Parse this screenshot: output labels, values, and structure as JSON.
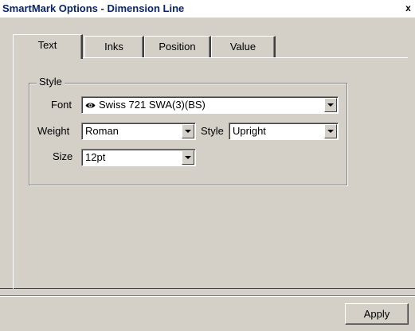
{
  "window": {
    "title": "SmartMark Options - Dimension Line",
    "close_label": "x"
  },
  "tabs": [
    {
      "label": "Text",
      "active": true
    },
    {
      "label": "Inks",
      "active": false
    },
    {
      "label": "Position",
      "active": false
    },
    {
      "label": "Value",
      "active": false
    }
  ],
  "style_group": {
    "legend": "Style",
    "font": {
      "label": "Font",
      "value": "Swiss 721 SWA(3)(BS)",
      "icon": "eye-icon"
    },
    "weight": {
      "label": "Weight",
      "value": "Roman"
    },
    "style": {
      "label": "Style",
      "value": "Upright"
    },
    "size": {
      "label": "Size",
      "value": "12pt"
    }
  },
  "footer": {
    "apply_label": "Apply"
  }
}
